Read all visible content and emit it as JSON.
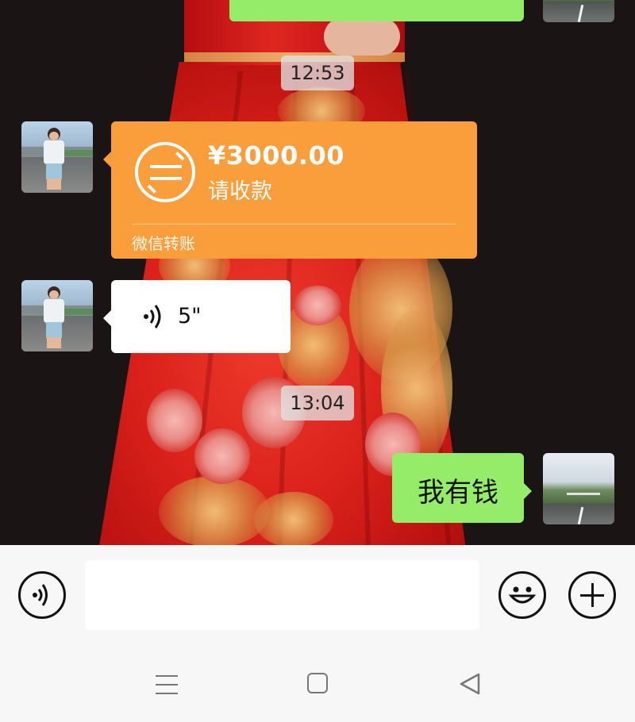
{
  "chat": {
    "timestamps": [
      "12:53",
      "13:04"
    ],
    "transfer": {
      "amount": "¥3000.00",
      "note": "请收款",
      "footer": "微信转账",
      "color": "#fa9d3b"
    },
    "voice_message": {
      "duration": "5\""
    },
    "outgoing_message": {
      "text": "我有钱",
      "color": "#95ec69"
    }
  },
  "input_bar": {
    "text_value": "",
    "icons": [
      "voice-icon",
      "emoji-icon",
      "plus-icon"
    ]
  },
  "nav_bar": {
    "icons": [
      "menu-icon",
      "home-icon",
      "back-icon"
    ]
  }
}
